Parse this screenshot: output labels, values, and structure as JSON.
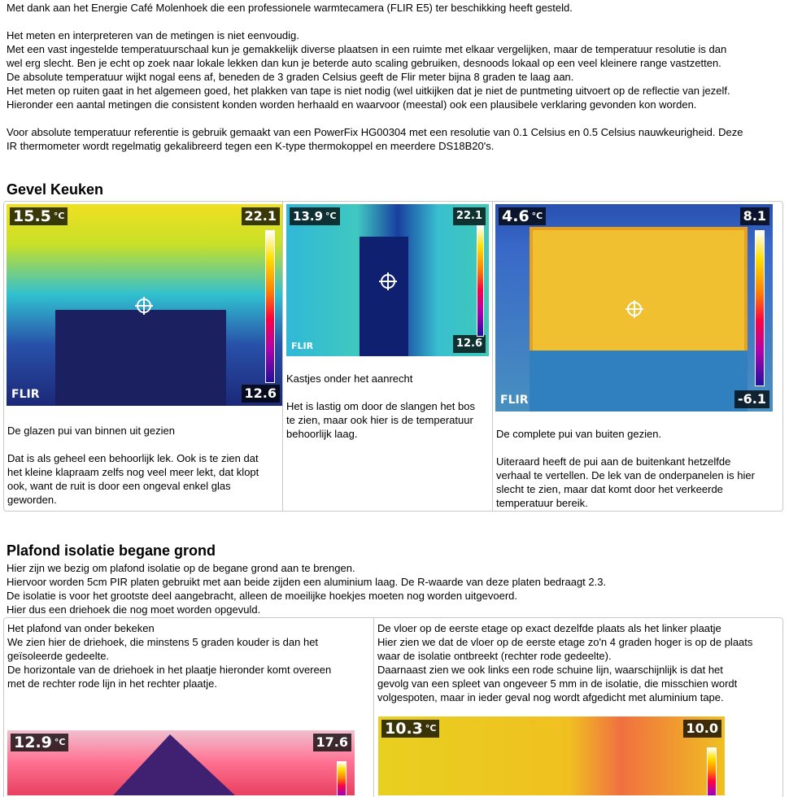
{
  "intro": {
    "thanks": "Met dank aan  het  Energie Café Molenhoek die een professionele warmtecamera (FLIR E5)  ter beschikking  heeft gesteld.",
    "lines": [
      "Het meten en interpreteren van de metingen is niet eenvoudig.",
      "Met een vast ingestelde temperatuurschaal  kun je gemakkelijk diverse plaatsen  in een ruimte met elkaar vergelijken, maar de temperatuur resolutie is  dan",
      "wel erg slecht. Ben je echt op zoek naar  lokale lekken dan kun je beterde auto scaling  gebruiken, desnoods lokaal  op  een veel kleinere range vastzetten.",
      "De absolute temperatuur wijkt nogal eens af,  beneden de 3 graden Celsius geeft de Flir meter bijna 8  graden te laag  aan.",
      "Het meten op ruiten gaat in  het algemeen goed, het plakken van tape is  niet nodig (wel uitkijken dat je niet de puntmeting uitvoert op de reflectie van jezelf.",
      "Hieronder een aantal  metingen die consistent  konden worden herhaald  en waarvoor  (meestal) ook een plausibele verklaring  gevonden kon worden."
    ],
    "reference": [
      "Voor absolute temperatuur referentie is gebruik gemaakt van  een PowerFix HG00304  met een resolutie van 0.1  Celsius  en 0.5  Celsius  nauwkeurigheid. Deze",
      "IR thermometer wordt regelmatig  gekalibreerd tegen een K-type  thermokoppel en meerdere DS18B20's."
    ]
  },
  "section1": {
    "heading": "Gevel Keuken",
    "cells": [
      {
        "temp": "15.5",
        "unit": "°C",
        "max": "22.1",
        "min": "12.6",
        "logo": "FLIR",
        "text": [
          "De glazen pui van binnen uit gezien",
          "",
          "Dat is als  geheel een behoorlijk lek. Ook is  te zien dat",
          "het kleine klapraam zelfs nog veel meer lekt, dat klopt",
          "ook, want de ruit is  door een ongeval enkel glas",
          "geworden."
        ]
      },
      {
        "temp": "13.9",
        "unit": "°C",
        "max": "22.1",
        "min": "12.6",
        "logo": "FLIR",
        "text": [
          "Kastjes onder het aanrecht",
          "",
          "Het is lastig  om door de slangen het bos",
          "te zien, maar ook hier is  de temperatuur",
          "behoorlijk laag."
        ]
      },
      {
        "temp": "4.6",
        "unit": "°C",
        "max": "8.1",
        "min": "-6.1",
        "logo": "FLIR",
        "text": [
          "De complete pui van buiten gezien.",
          "",
          "Uiteraard  heeft de pui aan  de buitenkant hetzelfde",
          "verhaal  te vertellen. De lek van de onderpanelen is  hier",
          "slecht te zien, maar dat komt door het verkeerde",
          "temperatuur bereik."
        ]
      }
    ]
  },
  "section2": {
    "heading": "Plafond isolatie  begane grond",
    "lines": [
      "Hier zijn we bezig om plafond isolatie  op de begane grond aan  te brengen.",
      "Hiervoor worden 5cm PIR platen gebruikt met aan  beide zijden een aluminium laag.  De R-waarde van deze platen bedraagt 2.3.",
      "De isolatie is  voor het grootste deel aangebracht,  alleen de moeilijke hoekjes moeten nog worden uitgevoerd.",
      "Hier dus een driehoek die nog moet worden opgevuld."
    ],
    "cells": [
      {
        "temp": "12.9",
        "unit": "°C",
        "max": "17.6",
        "text": [
          "Het plafond van onder bekeken",
          "We zien hier de driehoek, die minstens  5 graden kouder is dan het",
          "geïsoleerde gedeelte.",
          "De horizontale van de driehoek in het plaatje hieronder komt overeen",
          "met de  rechter rode lijn  in het rechter plaatje."
        ]
      },
      {
        "temp": "10.3",
        "unit": "°C",
        "max": "10.0",
        "text": [
          "De vloer  op de eerste etage op exact dezelfde plaats als  het linker plaatje",
          "Hier zien we dat de vloer op de eerste etage zo'n 4 graden hoger is op de plaats",
          "waar de isolatie  ontbreekt (rechter rode gedeelte).",
          "Daarnaast  zien we ook links  een rode schuine lijn,  waarschijnlijk  is  dat het",
          "gevolg van een spleet van ongeveer 5 mm in de isolatie,  die misschien wordt",
          "volgespoten, maar in ieder geval nog wordt afgedicht met aluminium tape."
        ]
      }
    ]
  }
}
